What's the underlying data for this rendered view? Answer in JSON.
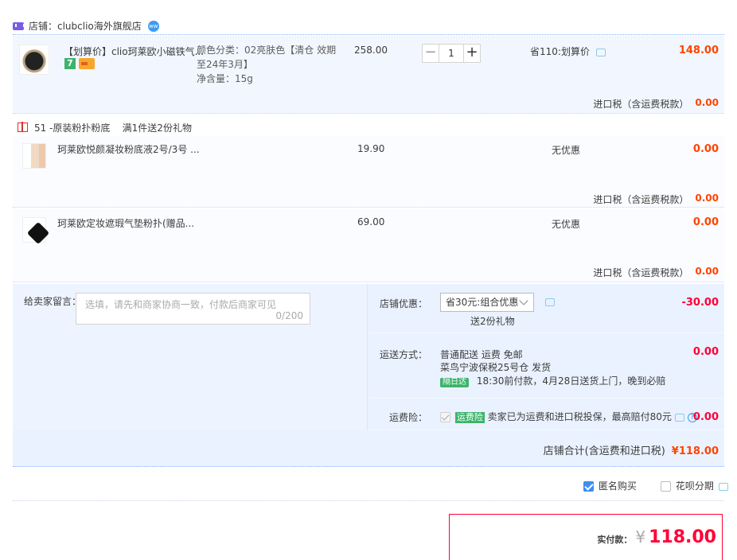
{
  "shop": {
    "name": "店铺：clubclio海外旗舰店"
  },
  "main_item": {
    "title": "【划算价】clio珂莱欧小磁铁气...",
    "sku_lines": [
      "颜色分类：02亮肤色【清仓 效期",
      "至24年3月】",
      "净含量：15g"
    ],
    "price": "258.00",
    "quantity": "1",
    "promo": "省110:划算价",
    "subtotal": "148.00",
    "tax_label": "进口税（含运费税款）",
    "tax_value": "0.00"
  },
  "gift_group": {
    "label": "51 -原装粉扑粉底    满1件送2份礼物"
  },
  "gift_items": [
    {
      "title": "珂莱欧悦颜凝妆粉底液2号/3号 ...",
      "price": "19.90",
      "promo": "无优惠",
      "subtotal": "0.00",
      "tax_label": "进口税（含运费税款）",
      "tax_value": "0.00"
    },
    {
      "title": "珂莱欧定妆遮瑕气垫粉扑(赠品...",
      "price": "69.00",
      "promo": "无优惠",
      "subtotal": "0.00",
      "tax_label": "进口税（含运费税款）",
      "tax_value": "0.00"
    }
  ],
  "message": {
    "label": "给卖家留言：",
    "placeholder": "选填，请先和商家协商一致，付款后商家可见",
    "count": "0/200"
  },
  "shop_discount": {
    "label": "店铺优惠：",
    "selected": "省30元:组合优惠",
    "note": "送2份礼物",
    "value": "-30.00"
  },
  "shipping": {
    "label": "运送方式：",
    "line1": "普通配送 运费 免邮",
    "line2": "菜鸟宁波保税25号仓  发货",
    "badge": "隔日达",
    "line3": "18:30前付款，4月28日送货上门，晚到必赔",
    "value": "0.00"
  },
  "shipping_insurance": {
    "label": "运费险：",
    "badge": "运费险",
    "text": "卖家已为运费和进口税投保，最高赔付80元",
    "value": "0.00"
  },
  "shop_total": {
    "label": "店铺合计(含运费和进口税)",
    "value": "¥118.00"
  },
  "options": {
    "anonymous": "匿名购买",
    "huabei": "花呗分期"
  },
  "final": {
    "label": "实付款：",
    "currency": "¥",
    "amount": "118.00"
  },
  "colors": {
    "accent_orange": "#ff4400",
    "accent_red": "#ff0036",
    "highlight_bg": "#eaf2ff",
    "checkbox_blue": "#3c8ef3"
  }
}
